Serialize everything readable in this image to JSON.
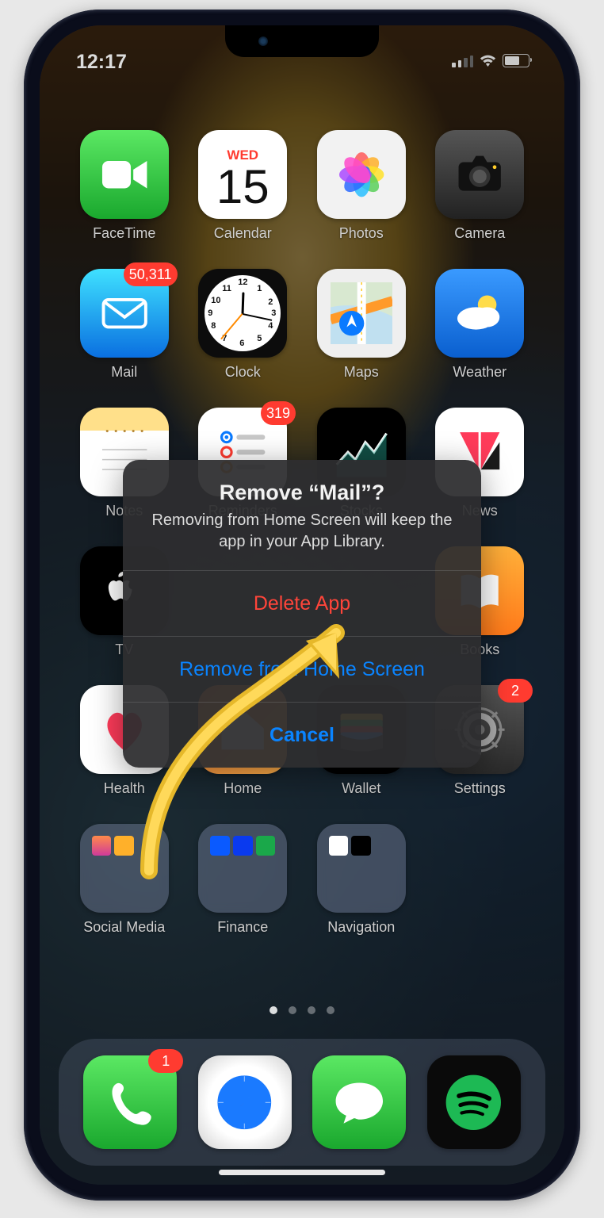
{
  "status": {
    "time": "12:17"
  },
  "calendar": {
    "weekday": "WED",
    "day": "15"
  },
  "apps_row1": [
    {
      "label": "FaceTime"
    },
    {
      "label": "Calendar"
    },
    {
      "label": "Photos"
    },
    {
      "label": "Camera"
    }
  ],
  "apps_row2": [
    {
      "label": "Mail",
      "badge": "50,311"
    },
    {
      "label": "Clock"
    },
    {
      "label": "Maps"
    },
    {
      "label": "Weather"
    }
  ],
  "apps_row3": [
    {
      "label": "Notes"
    },
    {
      "label": "Reminders",
      "badge": "319"
    },
    {
      "label": "Stocks"
    },
    {
      "label": "News"
    }
  ],
  "apps_row4": [
    {
      "label": "TV"
    },
    {
      "label": "Books"
    }
  ],
  "apps_row5": [
    {
      "label": "Health"
    },
    {
      "label": "Home"
    },
    {
      "label": "Wallet"
    },
    {
      "label": "Settings",
      "badge": "2"
    }
  ],
  "folders": [
    {
      "label": "Social Media"
    },
    {
      "label": "Finance"
    },
    {
      "label": "Navigation"
    }
  ],
  "dock_badges": {
    "phone": "1"
  },
  "alert": {
    "title": "Remove “Mail”?",
    "message": "Removing from Home Screen will keep the app in your App Library.",
    "delete": "Delete App",
    "remove": "Remove from Home Screen",
    "cancel": "Cancel"
  }
}
